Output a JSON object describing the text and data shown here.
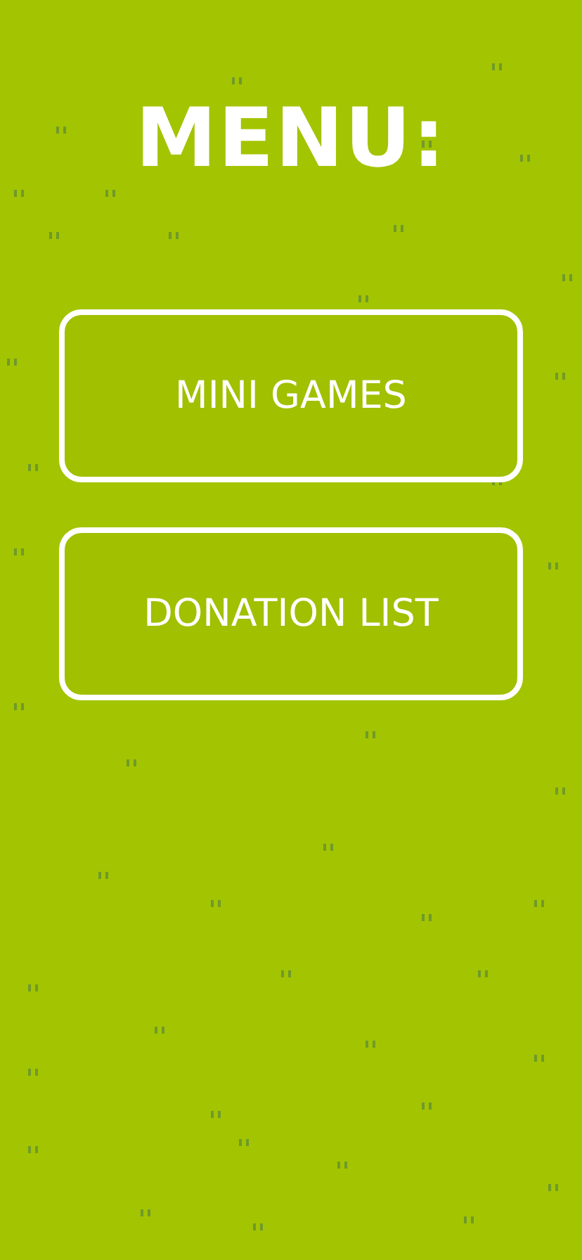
{
  "title": "MENU:",
  "buttons": [
    {
      "label": "MINI GAMES"
    },
    {
      "label": "DONATION LIST"
    }
  ]
}
